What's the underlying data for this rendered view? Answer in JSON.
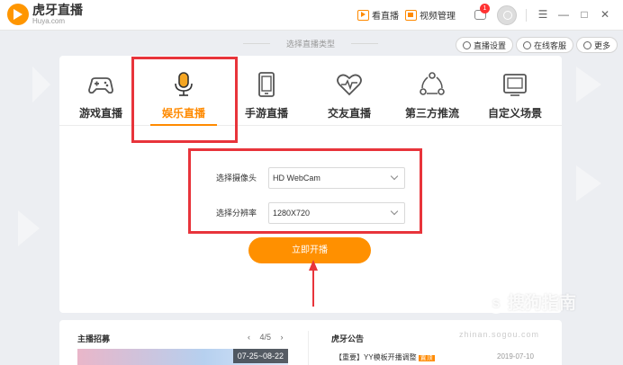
{
  "app": {
    "logo_cn": "虎牙直播",
    "logo_en": "Huya.com"
  },
  "titlebar": {
    "watch_live": "看直播",
    "video_manage": "视频管理",
    "message_badge": "1",
    "win_menu": "☰",
    "win_min": "—",
    "win_max": "□",
    "win_close": "✕"
  },
  "subheader": {
    "type_title": "选择直播类型",
    "settings_label": "直播设置",
    "service_label": "在线客服",
    "more_label": "更多"
  },
  "tabs": [
    {
      "label": "游戏直播",
      "icon": "gamepad-icon",
      "active": false
    },
    {
      "label": "娱乐直播",
      "icon": "microphone-icon",
      "active": true
    },
    {
      "label": "手游直播",
      "icon": "phone-icon",
      "active": false
    },
    {
      "label": "交友直播",
      "icon": "heart-icon",
      "active": false
    },
    {
      "label": "第三方推流",
      "icon": "share-icon",
      "active": false
    },
    {
      "label": "自定义场景",
      "icon": "monitor-icon",
      "active": false
    }
  ],
  "form": {
    "camera_label": "选择摄像头",
    "camera_value": "HD WebCam",
    "resolution_label": "选择分辨率",
    "resolution_value": "1280X720"
  },
  "start_button": "立即开播",
  "bottom": {
    "recruit_title": "主播招募",
    "pager_current": "4/5",
    "pager_prev": "‹",
    "pager_next": "›",
    "banner_date": "07-25~08-22",
    "notice_title": "虎牙公告",
    "notice_item": "【重要】YY模板开播调整",
    "notice_tag": "置顶",
    "notice_date": "2019-07-10"
  },
  "watermark": {
    "brand_letter": "S",
    "brand": "搜狗指南",
    "url": "zhinan.sogou.com"
  },
  "colors": {
    "accent": "#ff8a00",
    "annotation_red": "#e8343b"
  }
}
